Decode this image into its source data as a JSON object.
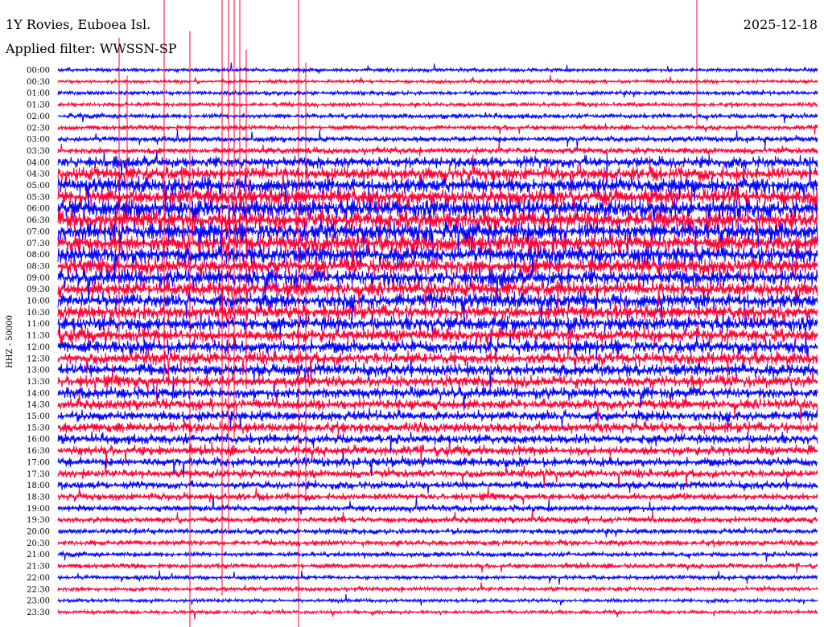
{
  "header": {
    "station": "1Y Rovies, Euboea Isl.",
    "date": "2025-12-18",
    "filter": "Applied filter: WWSSN-SP"
  },
  "chart_data": {
    "type": "line",
    "title": "1Y Rovies, Euboea Isl.",
    "subtitle": "Applied filter: WWSSN-SP",
    "date": "2025-12-18",
    "ylabel": "HHZ - 50000",
    "xlabel": "",
    "grid": false,
    "row_interval_minutes": 30,
    "row_labels": [
      "00:00",
      "00:30",
      "01:00",
      "01:30",
      "02:00",
      "02:30",
      "03:00",
      "03:30",
      "04:00",
      "04:30",
      "05:00",
      "05:30",
      "06:00",
      "06:30",
      "07:00",
      "07:30",
      "08:00",
      "08:30",
      "09:00",
      "09:30",
      "10:00",
      "10:30",
      "11:00",
      "11:30",
      "12:00",
      "12:30",
      "13:00",
      "13:30",
      "14:00",
      "14:30",
      "15:00",
      "15:30",
      "16:00",
      "16:30",
      "17:00",
      "17:30",
      "18:00",
      "18:30",
      "19:00",
      "19:30",
      "20:00",
      "20:30",
      "21:00",
      "21:30",
      "22:00",
      "22:30",
      "23:00",
      "23:30"
    ],
    "trace_colors": [
      "#0000ff",
      "#ff0033"
    ],
    "row_amplitude": [
      0.5,
      0.5,
      0.6,
      0.6,
      0.7,
      0.7,
      0.8,
      0.9,
      1.6,
      1.9,
      2.2,
      2.5,
      2.6,
      2.7,
      2.7,
      2.6,
      2.5,
      2.4,
      2.3,
      2.2,
      2.2,
      2.1,
      2.1,
      2.0,
      1.9,
      1.8,
      1.8,
      1.7,
      1.6,
      1.5,
      1.5,
      1.5,
      1.4,
      1.4,
      1.3,
      1.2,
      1.1,
      1.0,
      0.9,
      0.9,
      0.8,
      0.8,
      0.7,
      0.7,
      0.6,
      0.6,
      0.5,
      0.5
    ]
  }
}
